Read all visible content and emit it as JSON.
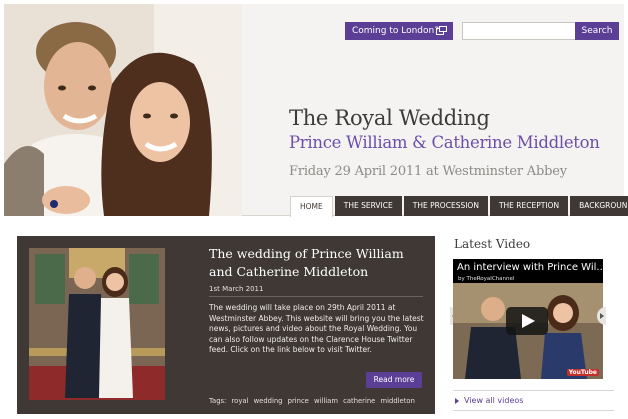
{
  "header": {
    "coming_to_london_label": "Coming to London?",
    "search_placeholder": "",
    "search_button_label": "Search",
    "title": "The Royal Wedding",
    "subtitle": "Prince William & Catherine Middleton",
    "dateline": "Friday 29 April 2011 at Westminster Abbey"
  },
  "nav": {
    "items": [
      {
        "label": "HOME",
        "active": true
      },
      {
        "label": "THE SERVICE",
        "active": false
      },
      {
        "label": "THE PROCESSION",
        "active": false
      },
      {
        "label": "THE RECEPTION",
        "active": false
      },
      {
        "label": "BACKGROUND",
        "active": false
      }
    ]
  },
  "feature": {
    "title": "The wedding of Prince William and Catherine Middleton",
    "date": "1st March 2011",
    "body": "The wedding will take place on 29th April 2011 at Westminster Abbey. This website will bring you the latest news, pictures and video about the Royal Wedding. You can also follow updates on the Clarence House Twitter feed. Click on the link below to visit Twitter.",
    "read_more_label": "Read more",
    "tags_label": "Tags:",
    "tags": [
      "royal",
      "wedding",
      "prince",
      "william",
      "catherine",
      "middleton"
    ]
  },
  "sidebar": {
    "heading": "Latest Video",
    "video_title": "An interview with Prince Wil...",
    "video_channel": "by TheRoyalChannel",
    "youtube_logo": "YouTube",
    "view_all_label": "View all videos"
  },
  "colors": {
    "accent_purple": "#5b3e96",
    "subtitle_purple": "#6b4fa8",
    "panel_brown": "#3f3834"
  },
  "icons": {
    "coming_to_london": "new-window-icon",
    "video_play": "play-icon",
    "carousel_prev": "chevron-left-icon",
    "carousel_next": "chevron-right-icon",
    "view_all": "triangle-right-icon"
  }
}
